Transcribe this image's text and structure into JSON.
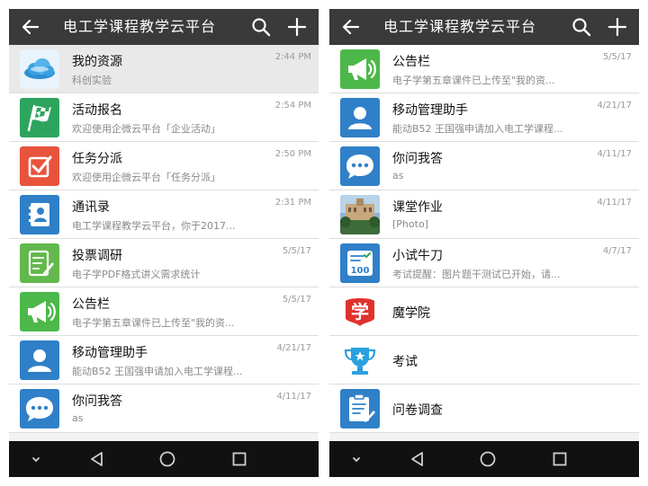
{
  "app": {
    "title": "电工学课程教学云平台",
    "theme": {
      "topbar": "#3a3a3a",
      "navbar": "#111111"
    }
  },
  "icons": {
    "back": "arrow-left-icon",
    "search": "search-icon",
    "add": "plus-icon",
    "nav": [
      "chevron-down-icon",
      "triangle-back-icon",
      "circle-home-icon",
      "square-recents-icon"
    ]
  },
  "left_screen": {
    "items": [
      {
        "title": "我的资源",
        "subtitle": "科创实验",
        "time": "2:44 PM",
        "icon": "cloud-icon",
        "color": "#e8f3fb"
      },
      {
        "title": "活动报名",
        "subtitle": "欢迎使用企微云平台「企业活动」",
        "time": "2:54 PM",
        "icon": "checkered-flag-icon",
        "color": "#2ea55f"
      },
      {
        "title": "任务分派",
        "subtitle": "欢迎使用企微云平台「任务分派」",
        "time": "2:50 PM",
        "icon": "checkbox-icon",
        "color": "#e8533b"
      },
      {
        "title": "通讯录",
        "subtitle": "电工学课程教学云平台，你于2017...",
        "time": "2:31 PM",
        "icon": "contacts-book-icon",
        "color": "#2f80c8"
      },
      {
        "title": "投票调研",
        "subtitle": "电子学PDF格式讲义需求统计",
        "time": "5/5/17",
        "icon": "vote-form-icon",
        "color": "#62b84c"
      },
      {
        "title": "公告栏",
        "subtitle": "电子学第五章课件已上传至\"我的资...",
        "time": "5/5/17",
        "icon": "megaphone-icon",
        "color": "#4db84a"
      },
      {
        "title": "移动管理助手",
        "subtitle": "能动B52 王国强申请加入电工学课程...",
        "time": "4/21/17",
        "icon": "person-icon",
        "color": "#2f80c8"
      },
      {
        "title": "你问我答",
        "subtitle": "as",
        "time": "4/11/17",
        "icon": "chat-bubble-icon",
        "color": "#2f80c8"
      }
    ]
  },
  "right_screen": {
    "items": [
      {
        "title": "公告栏",
        "subtitle": "电子学第五章课件已上传至\"我的资...",
        "time": "5/5/17",
        "icon": "megaphone-icon",
        "color": "#4db84a"
      },
      {
        "title": "移动管理助手",
        "subtitle": "能动B52 王国强申请加入电工学课程...",
        "time": "4/21/17",
        "icon": "person-icon",
        "color": "#2f80c8"
      },
      {
        "title": "你问我答",
        "subtitle": "as",
        "time": "4/11/17",
        "icon": "chat-bubble-icon",
        "color": "#2f80c8"
      },
      {
        "title": "课堂作业",
        "subtitle": "[Photo]",
        "time": "4/11/17",
        "icon": "campus-photo-icon",
        "color": "#6a8fb0"
      },
      {
        "title": "小试牛刀",
        "subtitle": "考试提醒：图片题干测试已开始，请...",
        "time": "4/7/17",
        "icon": "score-100-icon",
        "color": "#2f80c8"
      },
      {
        "title": "魔学院",
        "subtitle": "",
        "time": "",
        "icon": "xue-logo-icon",
        "color": "#e0322d"
      },
      {
        "title": "考试",
        "subtitle": "",
        "time": "",
        "icon": "trophy-icon",
        "color": "#2aa0e0"
      },
      {
        "title": "问卷调查",
        "subtitle": "",
        "time": "",
        "icon": "questionnaire-icon",
        "color": "#2f80c8"
      }
    ]
  }
}
